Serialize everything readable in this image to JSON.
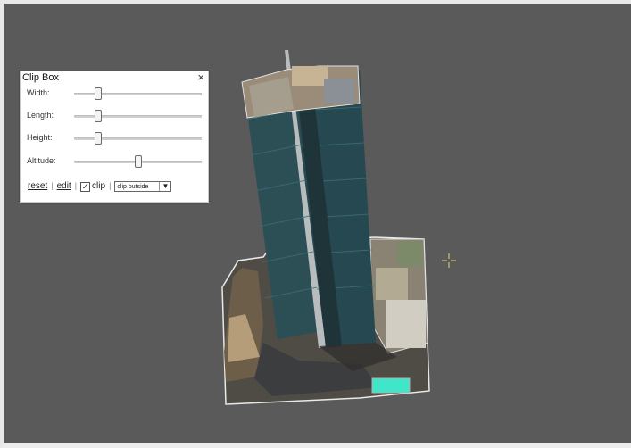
{
  "clip_box": {
    "title": "Clip Box",
    "close_glyph": "×",
    "sliders": [
      {
        "label": "Width:",
        "value": 0.19
      },
      {
        "label": "Length:",
        "value": 0.19
      },
      {
        "label": "Height:",
        "value": 0.19
      },
      {
        "label": "Altitude:",
        "value": 0.5
      }
    ],
    "reset_label": "reset",
    "edit_label": "edit",
    "clip_label": "clip",
    "clip_checked": true,
    "separator": "|",
    "mode_select": {
      "selected": "clip outside"
    }
  },
  "viewport": {
    "background_color": "#5a5a5a",
    "crosshair_color": "#e9d27a"
  }
}
